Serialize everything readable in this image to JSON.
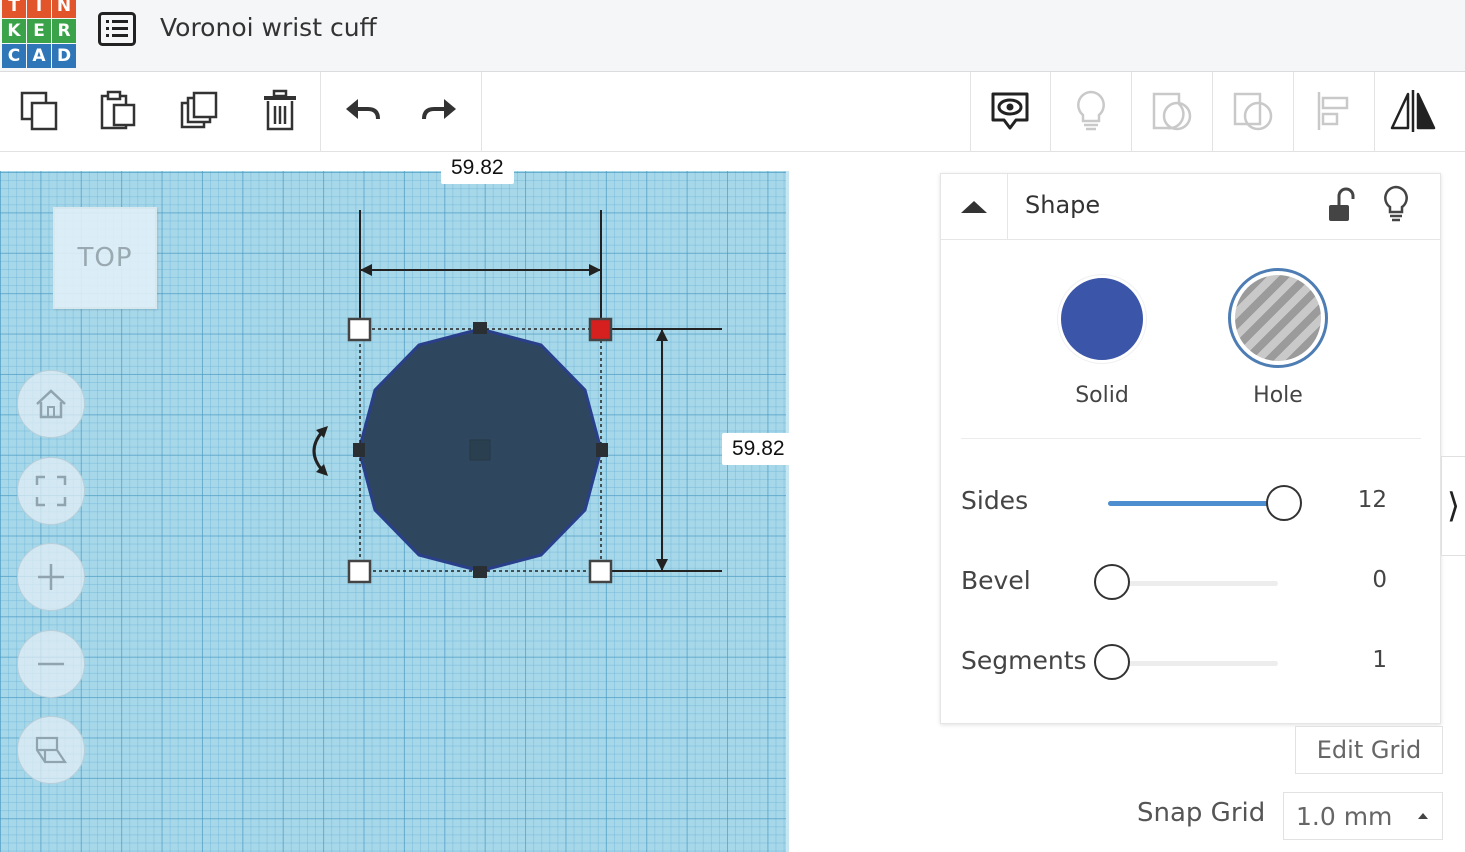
{
  "app": {
    "logo_letters": [
      "T",
      "I",
      "N",
      "K",
      "E",
      "R",
      "C",
      "A",
      "D"
    ],
    "logo_colors": [
      "#e2542a",
      "#e2542a",
      "#e2542a",
      "#3aa34a",
      "#3aa34a",
      "#3aa34a",
      "#2f76b8",
      "#2f76b8",
      "#2f76b8"
    ],
    "title": "Voronoi wrist cuff"
  },
  "toolbar": {
    "left_icons": [
      "copy-icon",
      "paste-icon",
      "duplicate-icon",
      "delete-icon",
      "undo-icon",
      "redo-icon"
    ],
    "right_icons": [
      "notes-icon",
      "light-bulb-icon",
      "group-icon",
      "ungroup-icon",
      "align-icon",
      "mirror-icon"
    ]
  },
  "workplane": {
    "view_label": "TOP",
    "width_dimension": "59.82",
    "height_dimension": "59.82",
    "shape_color": "#2e475f"
  },
  "shape_panel": {
    "title": "Shape",
    "solid_label": "Solid",
    "hole_label": "Hole",
    "solid_color": "#3b55a8",
    "properties": [
      {
        "label": "Sides",
        "value": "12",
        "fraction": 1.0
      },
      {
        "label": "Bevel",
        "value": "0",
        "fraction": 0.0
      },
      {
        "label": "Segments",
        "value": "1",
        "fraction": 0.0
      }
    ]
  },
  "grid": {
    "edit_grid_label": "Edit Grid",
    "snap_grid_label": "Snap Grid",
    "snap_grid_value": "1.0 mm"
  }
}
